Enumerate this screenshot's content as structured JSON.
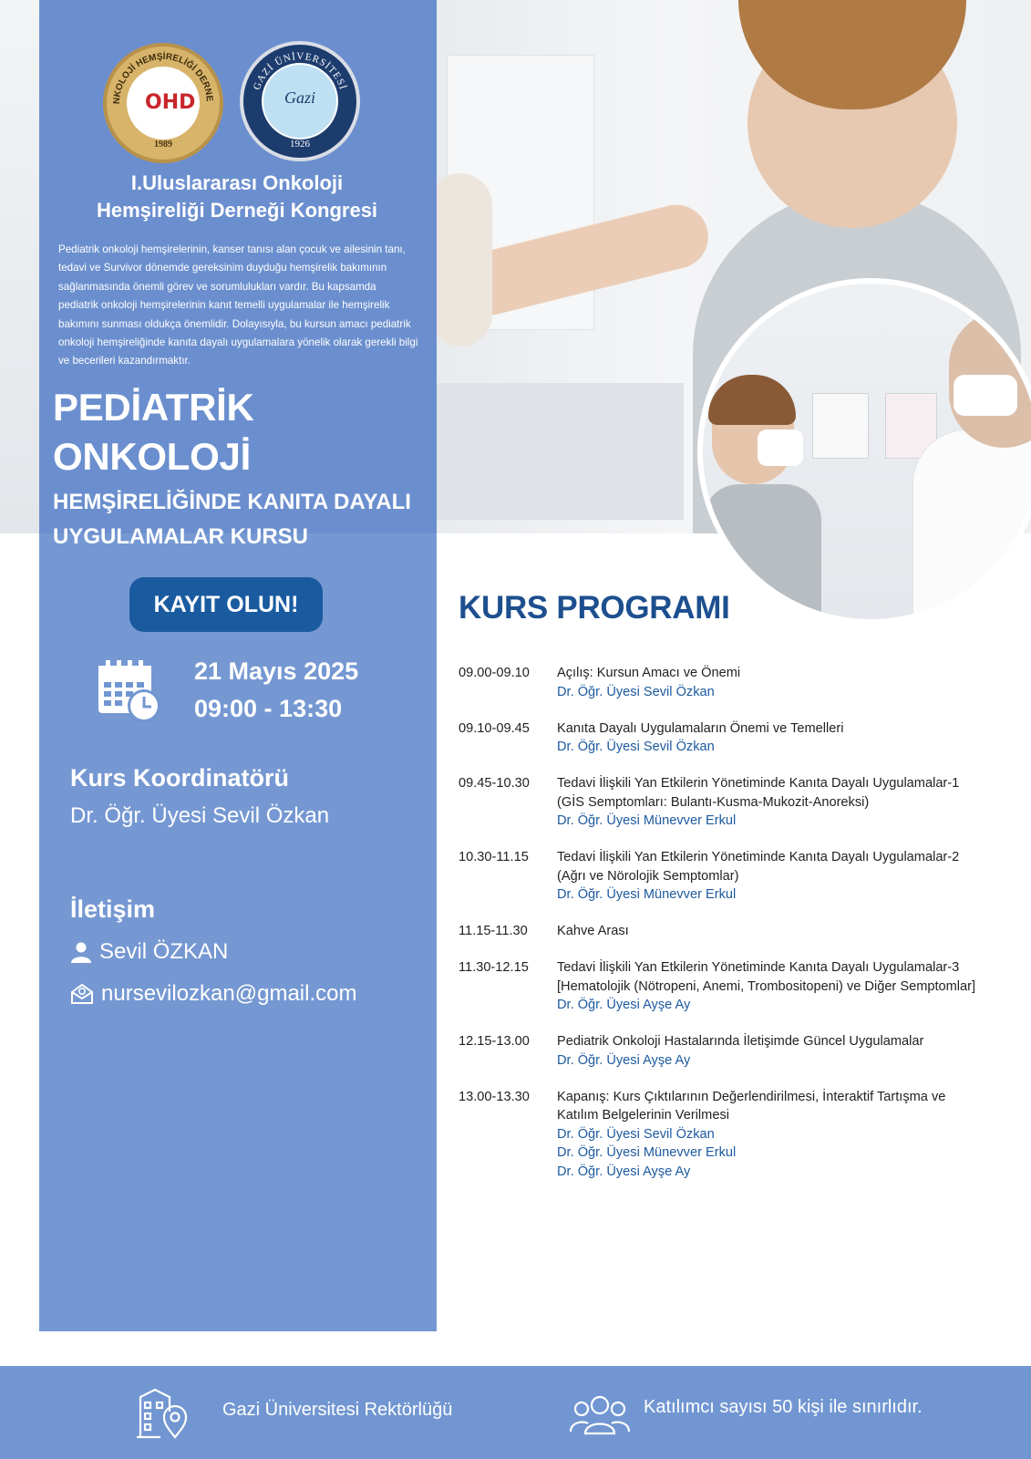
{
  "header": {
    "logo_left_text": "ONKOLOJİ HEMŞİRELİĞİ DERNEĞİ",
    "logo_left_mark": "OHD",
    "logo_left_year": "1989",
    "logo_right_text": "GAZİ ÜNİVERSİTESİ",
    "logo_right_signature": "Gazi",
    "logo_right_year": "1926",
    "congress_line1": "I.Uluslararası Onkoloji",
    "congress_line2": "Hemşireliği Derneği Kongresi"
  },
  "intro": "Pediatrik onkoloji hemşirelerinin, kanser tanısı alan çocuk ve ailesinin tanı, tedavi ve Survivor dönemde gereksinim duyduğu hemşirelik bakımının sağlanmasında önemli görev ve sorumlulukları vardır. Bu kapsamda pediatrik onkoloji hemşirelerinin kanıt temelli uygulamalar ile hemşirelik bakımını sunması oldukça önemlidir. Dolayısıyla, bu kursun amacı pediatrik onkoloji hemşireliğinde kanıta dayalı uygulamalara yönelik olarak gerekli bilgi ve becerileri kazandırmaktır.",
  "course_title": {
    "line1": "PEDİATRİK ONKOLOJİ",
    "line2": "HEMŞİRELİĞİNDE KANITA DAYALI",
    "line3": "UYGULAMALAR KURSU"
  },
  "register_button": "KAYIT OLUN!",
  "event": {
    "date": "21 Mayıs 2025",
    "time": "09:00 - 13:30"
  },
  "coordinator": {
    "title": "Kurs Koordinatörü",
    "name": "Dr. Öğr. Üyesi Sevil Özkan"
  },
  "contact": {
    "title": "İletişim",
    "person": "Sevil ÖZKAN",
    "email": "nursevilozkan@gmail.com"
  },
  "program": {
    "title": "KURS PROGRAMI",
    "items": [
      {
        "time": "09.00-09.10",
        "lines": [
          "Açılış: Kursun Amacı ve Önemi"
        ],
        "speakers": [
          "Dr. Öğr. Üyesi Sevil Özkan"
        ]
      },
      {
        "time": "09.10-09.45",
        "lines": [
          "Kanıta Dayalı Uygulamaların Önemi ve Temelleri"
        ],
        "speakers": [
          "Dr. Öğr. Üyesi Sevil Özkan"
        ]
      },
      {
        "time": "09.45-10.30",
        "lines": [
          "Tedavi İlişkili Yan Etkilerin Yönetiminde Kanıta Dayalı Uygulamalar-1",
          "(GİS Semptomları: Bulantı-Kusma-Mukozit-Anoreksi)"
        ],
        "speakers": [
          "Dr. Öğr. Üyesi Münevver Erkul"
        ]
      },
      {
        "time": "10.30-11.15",
        "lines": [
          "Tedavi İlişkili Yan Etkilerin Yönetiminde Kanıta Dayalı Uygulamalar-2",
          "(Ağrı ve Nörolojik Semptomlar)"
        ],
        "speakers": [
          "Dr. Öğr. Üyesi Münevver Erkul"
        ]
      },
      {
        "time": "11.15-11.30",
        "lines": [
          "Kahve Arası"
        ],
        "speakers": []
      },
      {
        "time": "11.30-12.15",
        "lines": [
          "Tedavi İlişkili Yan Etkilerin Yönetiminde Kanıta Dayalı Uygulamalar-3",
          "[Hematolojik (Nötropeni, Anemi, Trombositopeni) ve Diğer Semptomlar]"
        ],
        "speakers": [
          "Dr. Öğr. Üyesi Ayşe Ay"
        ]
      },
      {
        "time": "12.15-13.00",
        "lines": [
          "Pediatrik Onkoloji Hastalarında İletişimde Güncel Uygulamalar"
        ],
        "speakers": [
          "Dr. Öğr. Üyesi Ayşe Ay"
        ]
      },
      {
        "time": "13.00-13.30",
        "lines": [
          "Kapanış: Kurs Çıktılarının Değerlendirilmesi, İnteraktif Tartışma ve",
          "Katılım Belgelerinin Verilmesi"
        ],
        "speakers": [
          "Dr. Öğr. Üyesi Sevil Özkan",
          "Dr. Öğr. Üyesi Münevver Erkul",
          "Dr. Öğr. Üyesi Ayşe Ay"
        ]
      }
    ]
  },
  "footer": {
    "venue": "Gazi Üniversitesi Rektörlüğü",
    "capacity": "Katılımcı sayısı 50 kişi ile sınırlıdır."
  },
  "colors": {
    "panel_blue": "#7196d1",
    "button_blue": "#1a5ba0",
    "title_blue": "#1d4f8f",
    "speaker_blue": "#1d5aa0"
  }
}
